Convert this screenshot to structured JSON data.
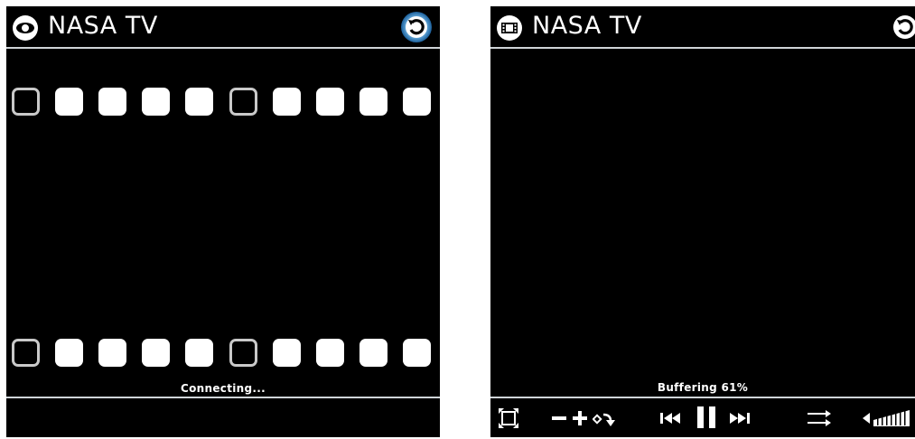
{
  "left_screen": {
    "title": "NASA TV",
    "app_icon": "eye-icon",
    "back_icon": "back-arrow-icon",
    "status": "Connecting...",
    "film_holes_pattern": [
      "empty",
      "filled",
      "filled",
      "filled",
      "filled",
      "empty",
      "filled",
      "filled",
      "filled",
      "filled"
    ]
  },
  "right_screen": {
    "title": "NASA TV",
    "app_icon": "film-icon",
    "back_icon": "back-arrow-icon",
    "status": "Buffering 61%",
    "buffering_percent": 61,
    "controls": [
      "fullscreen-icon",
      "zoom-out-icon",
      "zoom-in-icon",
      "rotate-icon",
      "previous-icon",
      "pause-icon",
      "next-icon",
      "repeat-icon",
      "volume-icon"
    ]
  },
  "colors": {
    "background": "#000000",
    "separator": "#cfd4d8",
    "text": "#ffffff",
    "back_button_glow": "#3a8fd0"
  }
}
